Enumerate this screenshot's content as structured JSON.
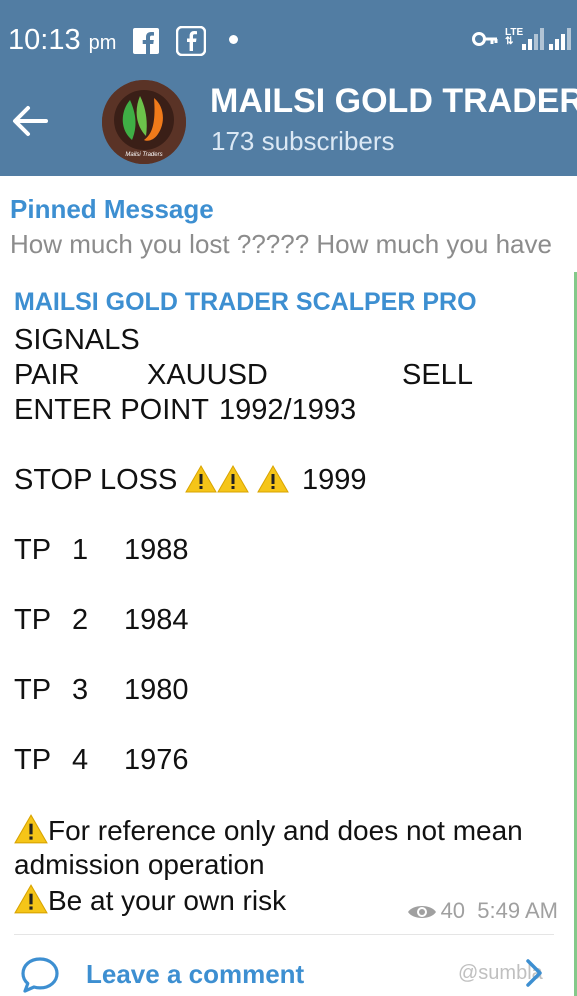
{
  "status_bar": {
    "time": "10:13",
    "ampm": "pm",
    "network": "LTE"
  },
  "channel": {
    "name": "MAILSI GOLD TRADER",
    "subscribers": "173 subscribers",
    "avatar_caption": "Mailsi Traders"
  },
  "pinned": {
    "title": "Pinned Message",
    "text": "How much you lost ????? How much you have"
  },
  "message": {
    "title": "MAILSI GOLD TRADER SCALPER PRO",
    "signals": "SIGNALS",
    "pair_label": "PAIR",
    "pair_value": "XAUUSD",
    "pair_action": "SELL",
    "enter_label": "ENTER POINT",
    "enter_value": "1992/1993",
    "stop_label": "STOP LOSS",
    "stop_value": "1999",
    "tp": [
      {
        "label": "TP",
        "num": "1",
        "value": "1988"
      },
      {
        "label": "TP",
        "num": "2",
        "value": "1984"
      },
      {
        "label": "TP",
        "num": "3",
        "value": "1980"
      },
      {
        "label": "TP",
        "num": "4",
        "value": "1976"
      }
    ],
    "disclaimer1a": "For reference only and does not mean",
    "disclaimer1b": "admission operation",
    "disclaimer2": "Be at your own risk",
    "views": "40",
    "time": "5:49 AM"
  },
  "comment": {
    "label": "Leave a comment",
    "watermark": "@sumbla"
  },
  "colors": {
    "header": "#527da3",
    "accent": "#3d8fd1",
    "warning": "#f5c518"
  },
  "icons": [
    "facebook-icon",
    "facebook-lite-icon",
    "key-icon",
    "signal-icon",
    "back-arrow-icon",
    "eye-icon",
    "warning-icon",
    "comment-icon",
    "chevron-right-icon"
  ]
}
